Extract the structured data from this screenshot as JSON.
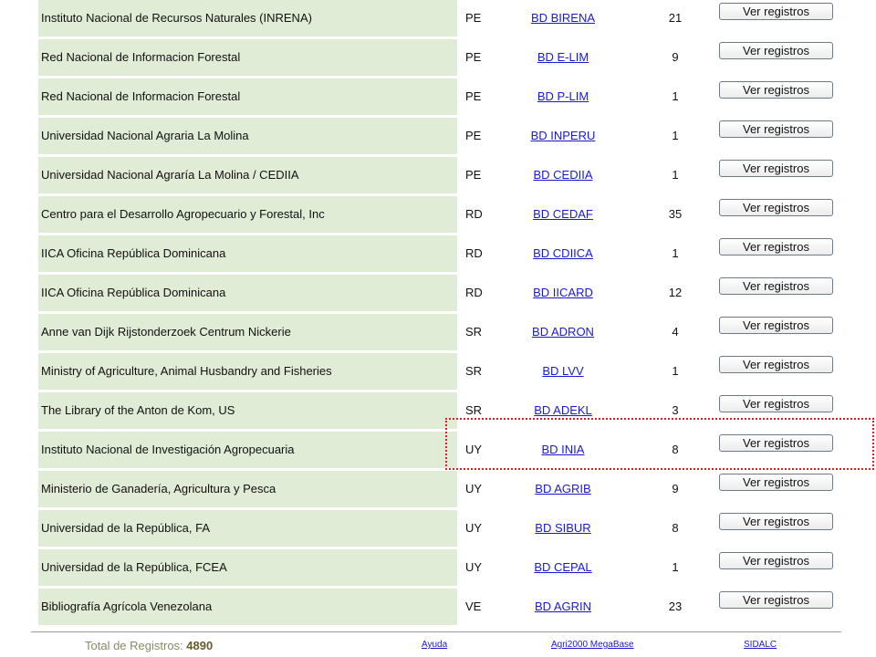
{
  "table": {
    "rows": [
      {
        "institution": "Instituto Nacional de Recursos Naturales (INRENA)",
        "country": "PE",
        "database": "BD BIRENA",
        "count": "21",
        "button": "Ver registros"
      },
      {
        "institution": "Red Nacional de Informacion Forestal",
        "country": "PE",
        "database": "BD E-LIM",
        "count": "9",
        "button": "Ver registros"
      },
      {
        "institution": "Red Nacional de Informacion Forestal",
        "country": "PE",
        "database": "BD P-LIM",
        "count": "1",
        "button": "Ver registros"
      },
      {
        "institution": "Universidad Nacional Agraria La Molina",
        "country": "PE",
        "database": "BD INPERU",
        "count": "1",
        "button": "Ver registros"
      },
      {
        "institution": "Universidad Nacional Agraría La Molina / CEDIIA",
        "country": "PE",
        "database": "BD CEDIIA",
        "count": "1",
        "button": "Ver registros"
      },
      {
        "institution": "Centro para el Desarrollo Agropecuario y Forestal, Inc",
        "country": "RD",
        "database": "BD CEDAF",
        "count": "35",
        "button": "Ver registros"
      },
      {
        "institution": "IICA Oficina República Dominicana",
        "country": "RD",
        "database": "BD CDIICA",
        "count": "1",
        "button": "Ver registros"
      },
      {
        "institution": "IICA Oficina República Dominicana",
        "country": "RD",
        "database": "BD IICARD",
        "count": "12",
        "button": "Ver registros"
      },
      {
        "institution": "Anne van Dijk Rijstonderzoek Centrum Nickerie",
        "country": "SR",
        "database": "BD ADRON",
        "count": "4",
        "button": "Ver registros"
      },
      {
        "institution": "Ministry of Agriculture, Animal Husbandry and Fisheries",
        "country": "SR",
        "database": "BD LVV",
        "count": "1",
        "button": "Ver registros"
      },
      {
        "institution": "The Library of the Anton de Kom, US",
        "country": "SR",
        "database": "BD ADEKL",
        "count": "3",
        "button": "Ver registros"
      },
      {
        "institution": "Instituto Nacional de Investigación Agropecuaria",
        "country": "UY",
        "database": "BD INIA",
        "count": "8",
        "button": "Ver registros"
      },
      {
        "institution": "Ministerio de Ganadería, Agricultura y Pesca",
        "country": "UY",
        "database": "BD AGRIB",
        "count": "9",
        "button": "Ver registros"
      },
      {
        "institution": "Universidad de la República, FA",
        "country": "UY",
        "database": "BD SIBUR",
        "count": "8",
        "button": "Ver registros"
      },
      {
        "institution": "Universidad de la República, FCEA",
        "country": "UY",
        "database": "BD CEPAL",
        "count": "1",
        "button": "Ver registros"
      },
      {
        "institution": "Bibliografía Agrícola Venezolana",
        "country": "VE",
        "database": "BD AGRIN",
        "count": "23",
        "button": "Ver registros"
      }
    ]
  },
  "highlight": {
    "color": "#d42020"
  },
  "footer": {
    "total_label": "Total de Registros:",
    "total_value": "4890",
    "links": [
      "Ayuda",
      "Agri2000 MegaBase",
      "SIDALC"
    ]
  },
  "colors": {
    "institution_cell": "#e1ecd7",
    "link": "#1a1ad6"
  }
}
